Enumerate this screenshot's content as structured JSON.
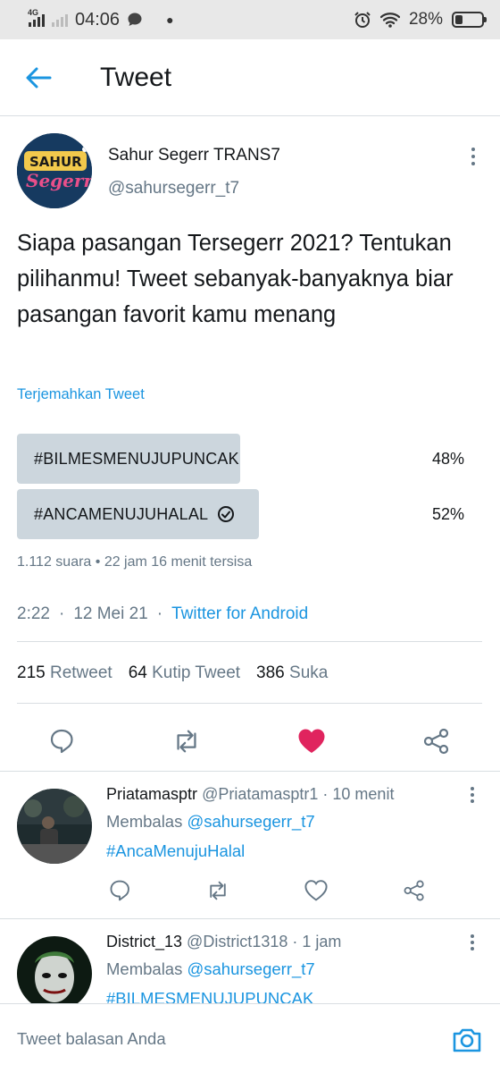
{
  "status_bar": {
    "network": "4G",
    "time": "04:06",
    "battery": "28%",
    "battery_level": 0.28
  },
  "header": {
    "title": "Tweet",
    "back_icon": "arrow-left-icon"
  },
  "tweet": {
    "author_name": "Sahur Segerr TRANS7",
    "author_handle": "@sahursegerr_t7",
    "avatar_text": "Sahur Segerr",
    "text": "Siapa pasangan Tersegerr 2021? Tentukan pilihanmu! Tweet sebanyak-banyaknya biar pasangan favorit kamu menang",
    "translate_label": "Terjemahkan Tweet",
    "poll": {
      "options": [
        {
          "label": "#BILMESMENUJUPUNCAK",
          "percent_label": "48%",
          "percent": 48,
          "selected": false
        },
        {
          "label": "#ANCAMENUJUHALAL",
          "percent_label": "52%",
          "percent": 52,
          "selected": true
        }
      ],
      "meta": "1.112 suara • 22 jam 16 menit tersisa"
    },
    "time": "2:22",
    "date": "12 Mei 21",
    "source": "Twitter for Android",
    "stats": {
      "retweets": "215",
      "retweets_label": "Retweet",
      "quotes": "64",
      "quotes_label": "Kutip Tweet",
      "likes": "386",
      "likes_label": "Suka"
    },
    "liked_color": "#e0245e",
    "accent_color": "#1b95e0"
  },
  "replies": [
    {
      "name": "Priatamasptr",
      "handle": "@Priatamasptr1",
      "time": "10 menit",
      "replying_prefix": "Membalas",
      "replying_to": "@sahursegerr_t7",
      "text": "#AncaMenujuHalal"
    },
    {
      "name": "District_13",
      "handle": "@District1318",
      "time": "1 jam",
      "replying_prefix": "Membalas",
      "replying_to": "@sahursegerr_t7",
      "text": "#BILMESMENUJUPUNCAK"
    }
  ],
  "composer": {
    "placeholder": "Tweet balasan Anda",
    "camera_icon": "camera-icon"
  }
}
